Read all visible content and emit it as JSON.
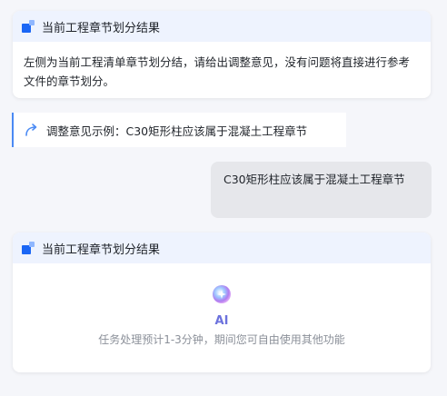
{
  "card1": {
    "title": "当前工程章节划分结果",
    "body": "左侧为当前工程清单章节划分结，请给出调整意见，没有问题将直接进行参考文件的章节划分。"
  },
  "hint": {
    "text": "调整意见示例：C30矩形柱应该属于混凝土工程章节"
  },
  "user_message": {
    "text": "C30矩形柱应该属于混凝土工程章节"
  },
  "card2": {
    "title": "当前工程章节划分结果",
    "ai_label": "AI",
    "status_text": "任务处理预计1-3分钟，期间您可自由使用其他功能"
  },
  "icons": {
    "brand": "brand-blocks-icon",
    "hint": "curved-arrow-icon",
    "ai": "ai-orb-icon"
  },
  "colors": {
    "accent": "#1a66f5",
    "header_bg": "#eef3fe",
    "user_bubble": "#e6e7eb",
    "ai_purple": "#6c72dd"
  }
}
